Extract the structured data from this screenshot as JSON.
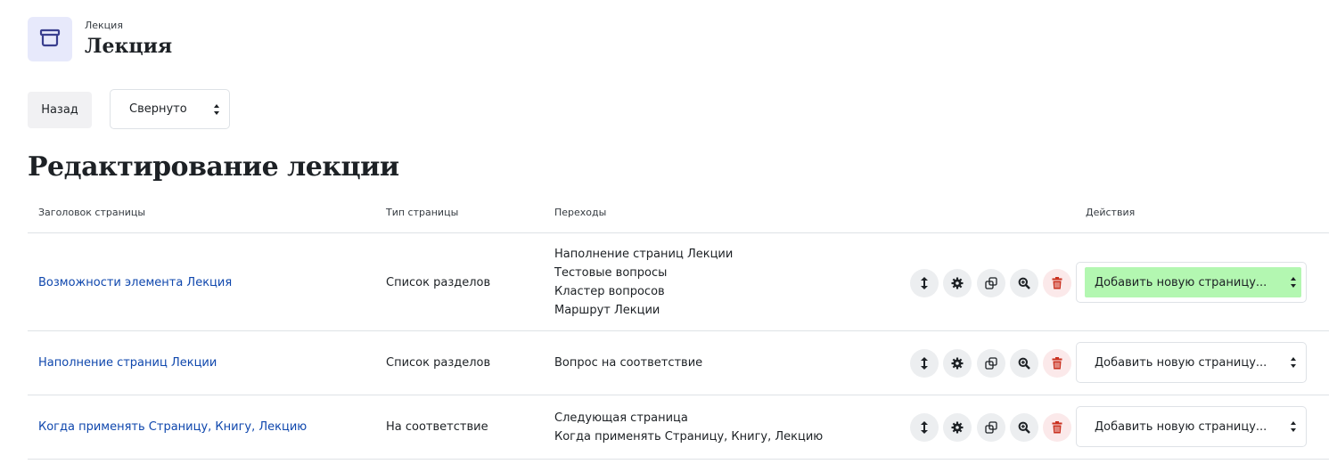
{
  "header": {
    "subtitle": "Лекция",
    "title": "Лекция",
    "icon": "lesson-icon",
    "icon_color": "#3a3f8f"
  },
  "toolbar": {
    "back_label": "Назад",
    "view_select_value": "Свернуто"
  },
  "page_heading": "Редактирование лекции",
  "table": {
    "columns": [
      "Заголовок страницы",
      "Тип страницы",
      "Переходы",
      "Действия"
    ],
    "rows": [
      {
        "title": "Возможности элемента Лекция",
        "type": "Список разделов",
        "jumps": [
          "Наполнение страниц Лекции",
          "Тестовые вопросы",
          "Кластер вопросов",
          "Маршрут Лекции"
        ],
        "add_select": "Добавить новую страницу..."
      },
      {
        "title": "Наполнение страниц Лекции",
        "type": "Список разделов",
        "jumps": [
          "Вопрос на соответствие"
        ],
        "add_select": "Добавить новую страницу..."
      },
      {
        "title": "Когда применять Страницу, Книгу, Лекцию",
        "type": "На соответствие",
        "jumps": [
          "Следующая страница",
          "Когда применять Страницу, Книгу, Лекцию"
        ],
        "add_select": "Добавить новую страницу..."
      }
    ]
  },
  "action_icons": [
    "move-icon",
    "gear-icon",
    "copy-icon",
    "zoom-icon",
    "trash-icon"
  ],
  "colors": {
    "link": "#0f47ad",
    "delete": "#ca3120",
    "highlight": "#b3f7b1"
  }
}
